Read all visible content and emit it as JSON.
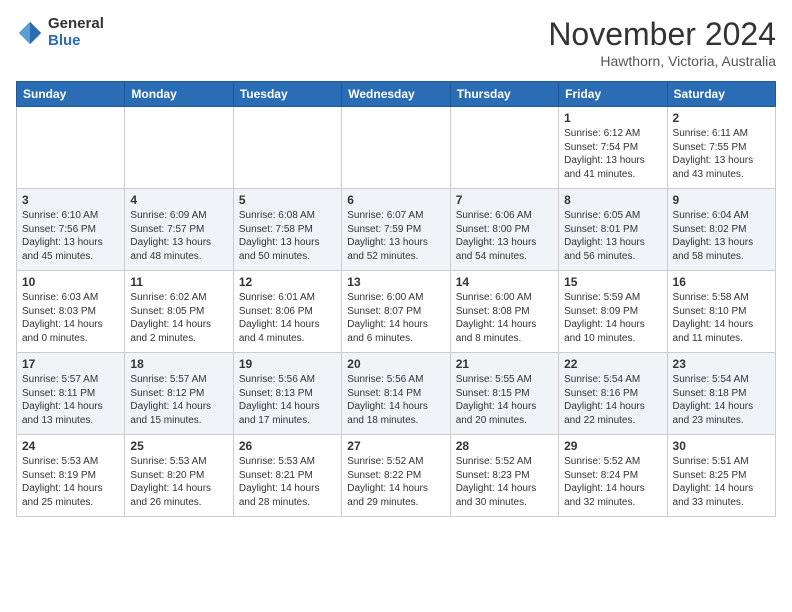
{
  "logo": {
    "general": "General",
    "blue": "Blue"
  },
  "title": "November 2024",
  "subtitle": "Hawthorn, Victoria, Australia",
  "days": [
    "Sunday",
    "Monday",
    "Tuesday",
    "Wednesday",
    "Thursday",
    "Friday",
    "Saturday"
  ],
  "weeks": [
    [
      {
        "day": "",
        "info": ""
      },
      {
        "day": "",
        "info": ""
      },
      {
        "day": "",
        "info": ""
      },
      {
        "day": "",
        "info": ""
      },
      {
        "day": "",
        "info": ""
      },
      {
        "day": "1",
        "info": "Sunrise: 6:12 AM\nSunset: 7:54 PM\nDaylight: 13 hours\nand 41 minutes."
      },
      {
        "day": "2",
        "info": "Sunrise: 6:11 AM\nSunset: 7:55 PM\nDaylight: 13 hours\nand 43 minutes."
      }
    ],
    [
      {
        "day": "3",
        "info": "Sunrise: 6:10 AM\nSunset: 7:56 PM\nDaylight: 13 hours\nand 45 minutes."
      },
      {
        "day": "4",
        "info": "Sunrise: 6:09 AM\nSunset: 7:57 PM\nDaylight: 13 hours\nand 48 minutes."
      },
      {
        "day": "5",
        "info": "Sunrise: 6:08 AM\nSunset: 7:58 PM\nDaylight: 13 hours\nand 50 minutes."
      },
      {
        "day": "6",
        "info": "Sunrise: 6:07 AM\nSunset: 7:59 PM\nDaylight: 13 hours\nand 52 minutes."
      },
      {
        "day": "7",
        "info": "Sunrise: 6:06 AM\nSunset: 8:00 PM\nDaylight: 13 hours\nand 54 minutes."
      },
      {
        "day": "8",
        "info": "Sunrise: 6:05 AM\nSunset: 8:01 PM\nDaylight: 13 hours\nand 56 minutes."
      },
      {
        "day": "9",
        "info": "Sunrise: 6:04 AM\nSunset: 8:02 PM\nDaylight: 13 hours\nand 58 minutes."
      }
    ],
    [
      {
        "day": "10",
        "info": "Sunrise: 6:03 AM\nSunset: 8:03 PM\nDaylight: 14 hours\nand 0 minutes."
      },
      {
        "day": "11",
        "info": "Sunrise: 6:02 AM\nSunset: 8:05 PM\nDaylight: 14 hours\nand 2 minutes."
      },
      {
        "day": "12",
        "info": "Sunrise: 6:01 AM\nSunset: 8:06 PM\nDaylight: 14 hours\nand 4 minutes."
      },
      {
        "day": "13",
        "info": "Sunrise: 6:00 AM\nSunset: 8:07 PM\nDaylight: 14 hours\nand 6 minutes."
      },
      {
        "day": "14",
        "info": "Sunrise: 6:00 AM\nSunset: 8:08 PM\nDaylight: 14 hours\nand 8 minutes."
      },
      {
        "day": "15",
        "info": "Sunrise: 5:59 AM\nSunset: 8:09 PM\nDaylight: 14 hours\nand 10 minutes."
      },
      {
        "day": "16",
        "info": "Sunrise: 5:58 AM\nSunset: 8:10 PM\nDaylight: 14 hours\nand 11 minutes."
      }
    ],
    [
      {
        "day": "17",
        "info": "Sunrise: 5:57 AM\nSunset: 8:11 PM\nDaylight: 14 hours\nand 13 minutes."
      },
      {
        "day": "18",
        "info": "Sunrise: 5:57 AM\nSunset: 8:12 PM\nDaylight: 14 hours\nand 15 minutes."
      },
      {
        "day": "19",
        "info": "Sunrise: 5:56 AM\nSunset: 8:13 PM\nDaylight: 14 hours\nand 17 minutes."
      },
      {
        "day": "20",
        "info": "Sunrise: 5:56 AM\nSunset: 8:14 PM\nDaylight: 14 hours\nand 18 minutes."
      },
      {
        "day": "21",
        "info": "Sunrise: 5:55 AM\nSunset: 8:15 PM\nDaylight: 14 hours\nand 20 minutes."
      },
      {
        "day": "22",
        "info": "Sunrise: 5:54 AM\nSunset: 8:16 PM\nDaylight: 14 hours\nand 22 minutes."
      },
      {
        "day": "23",
        "info": "Sunrise: 5:54 AM\nSunset: 8:18 PM\nDaylight: 14 hours\nand 23 minutes."
      }
    ],
    [
      {
        "day": "24",
        "info": "Sunrise: 5:53 AM\nSunset: 8:19 PM\nDaylight: 14 hours\nand 25 minutes."
      },
      {
        "day": "25",
        "info": "Sunrise: 5:53 AM\nSunset: 8:20 PM\nDaylight: 14 hours\nand 26 minutes."
      },
      {
        "day": "26",
        "info": "Sunrise: 5:53 AM\nSunset: 8:21 PM\nDaylight: 14 hours\nand 28 minutes."
      },
      {
        "day": "27",
        "info": "Sunrise: 5:52 AM\nSunset: 8:22 PM\nDaylight: 14 hours\nand 29 minutes."
      },
      {
        "day": "28",
        "info": "Sunrise: 5:52 AM\nSunset: 8:23 PM\nDaylight: 14 hours\nand 30 minutes."
      },
      {
        "day": "29",
        "info": "Sunrise: 5:52 AM\nSunset: 8:24 PM\nDaylight: 14 hours\nand 32 minutes."
      },
      {
        "day": "30",
        "info": "Sunrise: 5:51 AM\nSunset: 8:25 PM\nDaylight: 14 hours\nand 33 minutes."
      }
    ]
  ]
}
